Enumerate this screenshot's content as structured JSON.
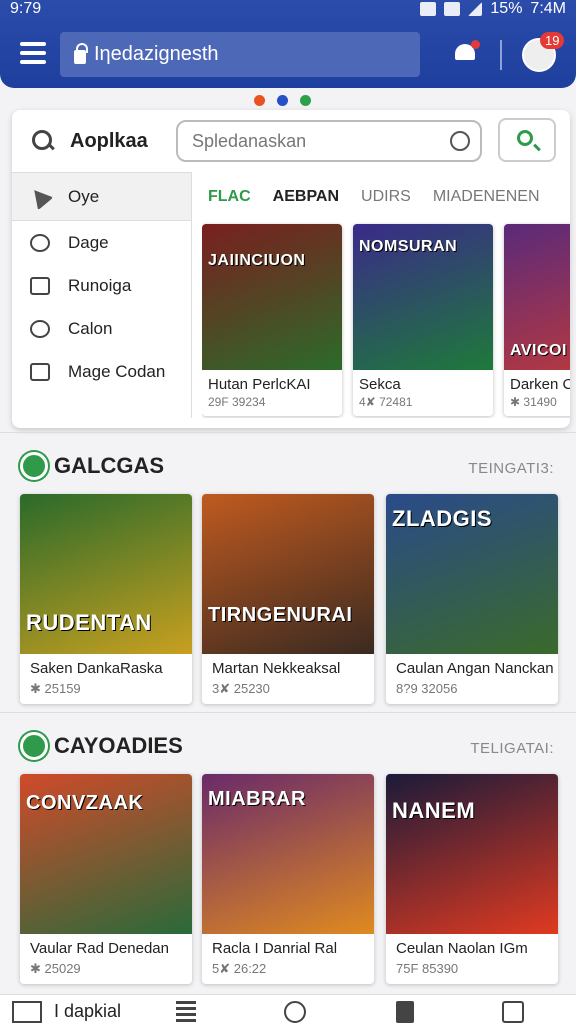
{
  "status": {
    "time": "9:79",
    "battery": "15%",
    "clock": "7:4M"
  },
  "header": {
    "search_text": "Iηedazignesth",
    "notification_count": "19"
  },
  "colors": {
    "header": "#2c4cab",
    "accent": "#2e9a4a",
    "dot1": "#e8531f",
    "dot2": "#2450c8",
    "dot3": "#2ea04a"
  },
  "panel": {
    "app_title": "Aoplkaa",
    "search_placeholder": "Spledanaskan",
    "menu": [
      {
        "label": "Oye",
        "icon": "location-arrow-icon"
      },
      {
        "label": "Dage",
        "icon": "clock-icon"
      },
      {
        "label": "Runoiga",
        "icon": "bag-icon"
      },
      {
        "label": "Calon",
        "icon": "glasses-icon"
      },
      {
        "label": "Mage Codan",
        "icon": "clipboard-icon"
      }
    ],
    "tabs": [
      "FLAC",
      "AEBPAN",
      "UDIRS",
      "MIADENENEN"
    ],
    "cards": [
      {
        "title": "Hutan PerlcKAI",
        "meta": "29F 39234",
        "art_text": "JAIINCIUON",
        "grad": "#7a1f1f,#2c6b2a"
      },
      {
        "title": "Sekca",
        "meta": "4✘ 72481",
        "art_text": "NOMSURAN",
        "grad": "#3a2a8a,#1e7a3a"
      },
      {
        "title": "Darken CaF",
        "meta": "✱ 31490",
        "art_text": "AVICOI",
        "grad": "#5a2a7a,#c03a3a"
      }
    ]
  },
  "section1": {
    "title": "GALCGAS",
    "link": "TEINGATI3:",
    "cards": [
      {
        "title": "Saken DankaRaska",
        "meta": "✱ 25159",
        "art_text": "RUDENTAN",
        "grad": "#2a6a2a,#c8a020"
      },
      {
        "title": "Martan Nekkeaksal",
        "meta": "3✘ 25230",
        "art_text": "TIRNGENURAI",
        "grad": "#c05a20,#3a2a20"
      },
      {
        "title": "Caulan Angan Nanckan",
        "meta": "8?9 32056",
        "art_text": "ZLADGIS",
        "grad": "#2a4a8a,#3a6a2a"
      }
    ]
  },
  "section2": {
    "title": "CAYOADIES",
    "link": "TELIGATAI:",
    "cards": [
      {
        "title": "Vaular Rad Denedan",
        "meta": "✱ 25029",
        "art_text": "CONVZAAK",
        "grad": "#d04a2a,#2a6a3a"
      },
      {
        "title": "Racla I Danrial Ral",
        "meta": "5✘ 26:22",
        "art_text": "MIABRAR",
        "grad": "#6a2a6a,#e08a20"
      },
      {
        "title": "Ceulan Naolan IGm",
        "meta": "75F 85390",
        "art_text": "NANEM",
        "grad": "#1a1a3a,#e03a20"
      }
    ]
  },
  "bottom_nav": {
    "label": "I dapkial"
  }
}
